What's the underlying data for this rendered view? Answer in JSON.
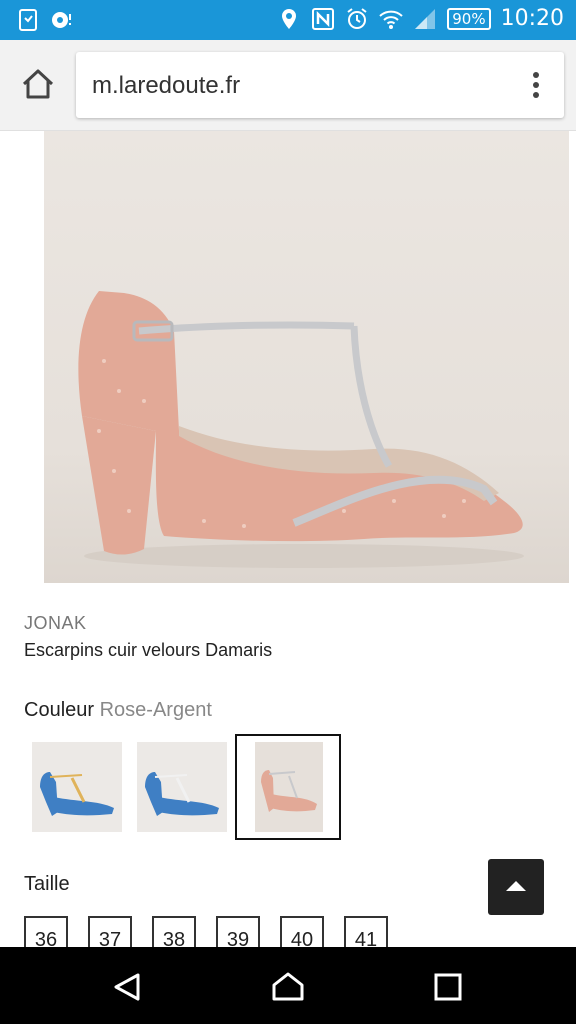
{
  "status_bar": {
    "battery": "90%",
    "time": "10:20",
    "background_color": "#1a96d8",
    "icons": [
      "sim-icon",
      "notification-icon",
      "location-icon",
      "nfc-icon",
      "alarm-icon",
      "wifi-icon",
      "signal-icon",
      "battery-icon"
    ]
  },
  "browser": {
    "url": "m.laredoute.fr",
    "icons": [
      "home-icon",
      "more-vert-icon"
    ]
  },
  "product": {
    "brand": "JONAK",
    "name": "Escarpins cuir velours Damaris",
    "color_label": "Couleur",
    "color_value": "Rose-Argent",
    "swatches": [
      {
        "color": "blue",
        "selected": false
      },
      {
        "color": "blue",
        "selected": false
      },
      {
        "color": "pink",
        "selected": true
      }
    ],
    "size_label": "Taille",
    "sizes": [
      "36",
      "37",
      "38",
      "39",
      "40",
      "41"
    ]
  },
  "colors": {
    "shoe_suede": "#e2a997",
    "strap": "#c8c9cc",
    "swatch_blue": "#3f7fc4"
  },
  "nav_bar": {
    "icons": [
      "back-icon",
      "home-icon",
      "recent-apps-icon"
    ]
  }
}
